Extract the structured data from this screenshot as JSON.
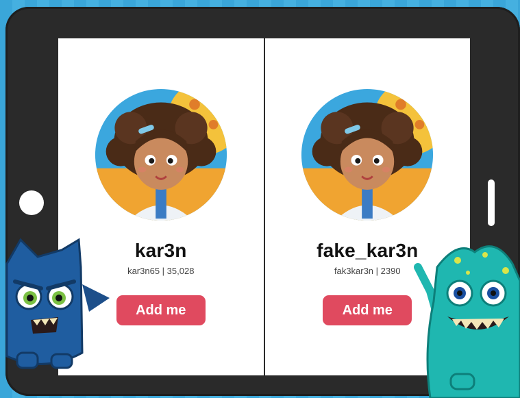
{
  "profiles": [
    {
      "username": "kar3n",
      "handle_line": "kar3n65 | 35,028",
      "button_label": "Add me"
    },
    {
      "username": "fake_kar3n",
      "handle_line": "fak3kar3n | 2390",
      "button_label": "Add me"
    }
  ],
  "colors": {
    "background": "#3aa6d9",
    "tablet": "#2a2a2a",
    "button": "#e04a5f",
    "avatar_sky": "#3ba7de",
    "avatar_sun": "#f4c23b"
  },
  "illustrations": [
    "blue-monster-illustration",
    "teal-monster-illustration"
  ]
}
